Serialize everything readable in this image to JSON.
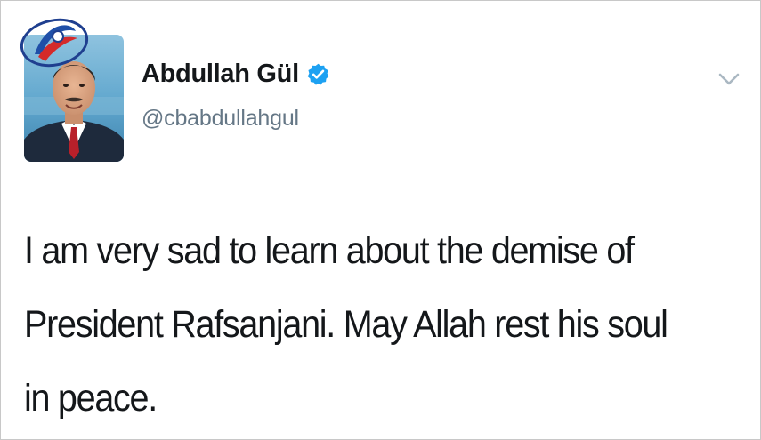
{
  "tweet": {
    "author": {
      "display_name": "Abdullah Gül",
      "handle": "@cbabdullahgul",
      "verified": true,
      "avatar_icon": "profile-photo"
    },
    "text": "I am very sad to learn about the demise of President Rafsanjani. May Allah rest his soul in peace.",
    "menu_icon": "chevron-down-icon"
  },
  "watermark": {
    "icon": "broadcaster-logo"
  },
  "colors": {
    "verified_badge": "#1da1f2",
    "handle_text": "#657786",
    "primary_text": "#14171a",
    "chevron": "#aab8c2"
  }
}
